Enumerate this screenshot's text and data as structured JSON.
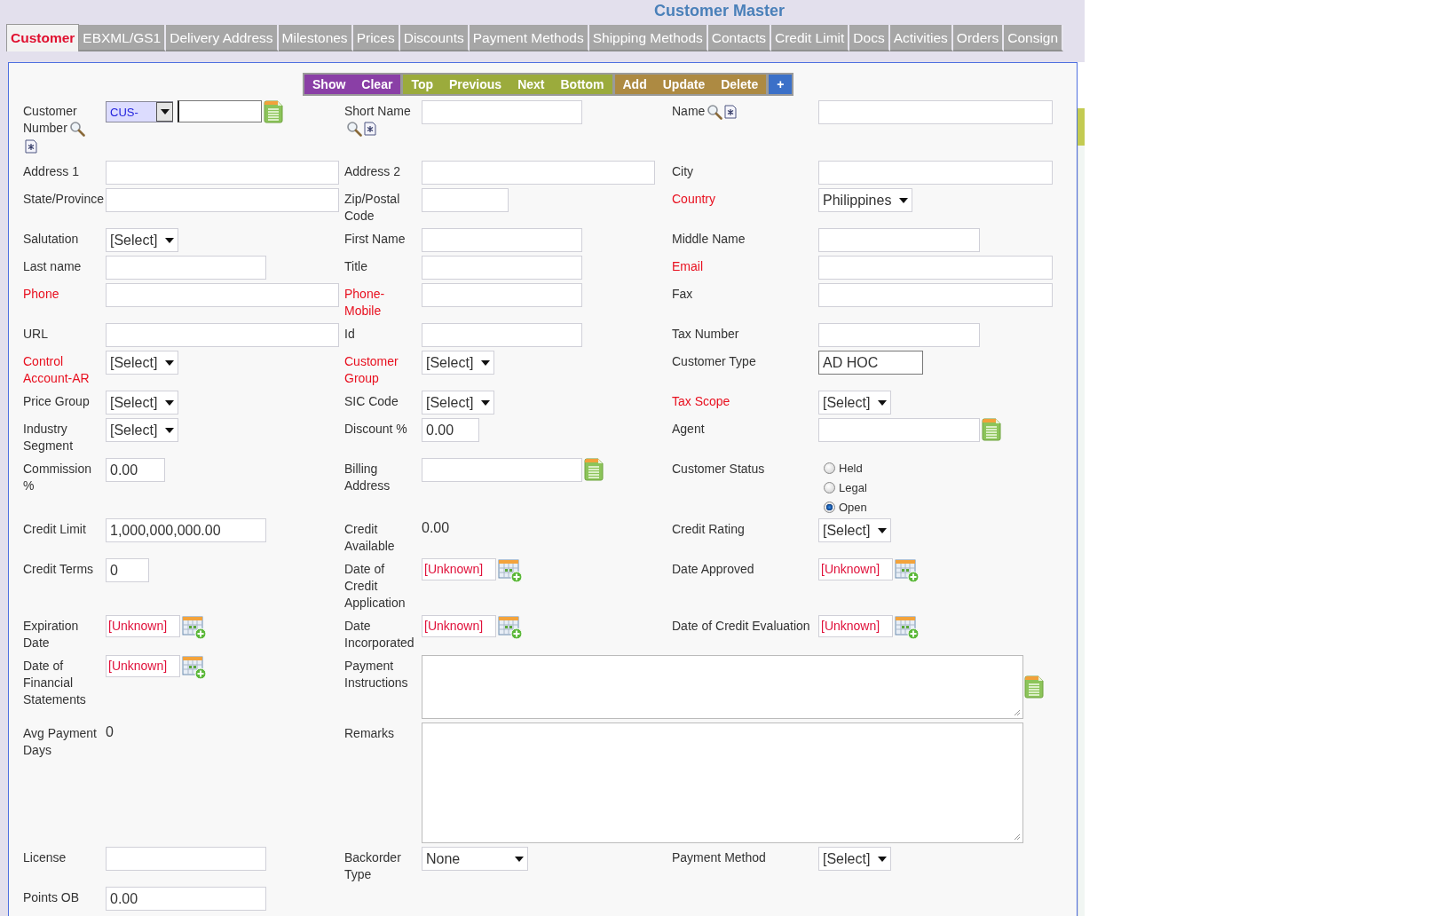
{
  "title": "Customer Master",
  "tabs": [
    {
      "label": "Customer",
      "selected": true
    },
    {
      "label": "EBXML/GS1",
      "selected": false
    },
    {
      "label": "Delivery Address",
      "selected": false
    },
    {
      "label": "Milestones",
      "selected": false
    },
    {
      "label": "Prices",
      "selected": false
    },
    {
      "label": "Discounts",
      "selected": false
    },
    {
      "label": "Payment Methods",
      "selected": false
    },
    {
      "label": "Shipping Methods",
      "selected": false
    },
    {
      "label": "Contacts",
      "selected": false
    },
    {
      "label": "Credit Limit",
      "selected": false
    },
    {
      "label": "Docs",
      "selected": false
    },
    {
      "label": "Activities",
      "selected": false
    },
    {
      "label": "Orders",
      "selected": false
    },
    {
      "label": "Consign",
      "selected": false
    }
  ],
  "toolbar": [
    {
      "label": "Show",
      "color": "#8a3fa6"
    },
    {
      "label": "Clear",
      "color": "#8a3fa6"
    },
    {
      "label": "Top",
      "color": "#9bab3c"
    },
    {
      "label": "Previous",
      "color": "#9bab3c"
    },
    {
      "label": "Next",
      "color": "#9bab3c"
    },
    {
      "label": "Bottom",
      "color": "#9bab3c"
    },
    {
      "label": "Add",
      "color": "#ad8a42"
    },
    {
      "label": "Update",
      "color": "#ad8a42"
    },
    {
      "label": "Delete",
      "color": "#ad8a42"
    },
    {
      "label": "+",
      "color": "#3b70c8"
    }
  ],
  "rows": [
    {
      "cells": [
        {
          "label": "Customer Number",
          "required": false,
          "lookup": true,
          "control": {
            "kind": "customer-number",
            "prefix": "CUS-"
          }
        },
        {
          "label": "Short Name",
          "required": false,
          "lookup": true,
          "control": {
            "kind": "text"
          }
        },
        {
          "label": "Name",
          "required": false,
          "lookup": true,
          "control": {
            "kind": "text"
          }
        }
      ]
    },
    {
      "cells": [
        {
          "label": "Address 1",
          "required": false,
          "control": {
            "kind": "text"
          }
        },
        {
          "label": "Address 2",
          "required": false,
          "control": {
            "kind": "text"
          }
        },
        {
          "label": "City",
          "required": false,
          "control": {
            "kind": "text"
          }
        }
      ]
    },
    {
      "cells": [
        {
          "label": "State/Province",
          "required": false,
          "control": {
            "kind": "text"
          }
        },
        {
          "label": "Zip/Postal Code",
          "required": false,
          "control": {
            "kind": "text"
          }
        },
        {
          "label": "Country",
          "required": true,
          "control": {
            "kind": "select",
            "value": "Philippines"
          }
        }
      ]
    },
    {
      "cells": [
        {
          "label": "Salutation",
          "required": false,
          "control": {
            "kind": "select",
            "value": "[Select]"
          }
        },
        {
          "label": "First Name",
          "required": false,
          "control": {
            "kind": "text"
          }
        },
        {
          "label": "Middle Name",
          "required": false,
          "control": {
            "kind": "text"
          }
        }
      ]
    },
    {
      "cells": [
        {
          "label": "Last name",
          "required": false,
          "control": {
            "kind": "text"
          }
        },
        {
          "label": "Title",
          "required": false,
          "control": {
            "kind": "text"
          }
        },
        {
          "label": "Email",
          "required": true,
          "control": {
            "kind": "text"
          }
        }
      ]
    },
    {
      "cells": [
        {
          "label": "Phone",
          "required": true,
          "control": {
            "kind": "text"
          }
        },
        {
          "label": "Phone-Mobile",
          "required": true,
          "control": {
            "kind": "text"
          }
        },
        {
          "label": "Fax",
          "required": false,
          "control": {
            "kind": "text"
          }
        }
      ]
    },
    {
      "cells": [
        {
          "label": "URL",
          "required": false,
          "control": {
            "kind": "text"
          }
        },
        {
          "label": "Id",
          "required": false,
          "control": {
            "kind": "text"
          }
        },
        {
          "label": "Tax Number",
          "required": false,
          "control": {
            "kind": "text"
          }
        }
      ]
    },
    {
      "cells": [
        {
          "label": "Control Account-AR",
          "required": true,
          "control": {
            "kind": "select",
            "value": "[Select]"
          }
        },
        {
          "label": "Customer Group",
          "required": true,
          "control": {
            "kind": "select",
            "value": "[Select]"
          }
        },
        {
          "label": "Customer Type",
          "required": false,
          "control": {
            "kind": "text",
            "value": "AD HOC"
          }
        }
      ]
    },
    {
      "cells": [
        {
          "label": "Price Group",
          "required": false,
          "control": {
            "kind": "select",
            "value": "[Select]"
          }
        },
        {
          "label": "SIC Code",
          "required": false,
          "control": {
            "kind": "select",
            "value": "[Select]"
          }
        },
        {
          "label": "Tax Scope",
          "required": true,
          "control": {
            "kind": "select",
            "value": "[Select]"
          }
        }
      ]
    },
    {
      "cells": [
        {
          "label": "Industry Segment",
          "required": false,
          "control": {
            "kind": "select",
            "value": "[Select]"
          }
        },
        {
          "label": "Discount %",
          "required": false,
          "control": {
            "kind": "text",
            "value": "0.00"
          }
        },
        {
          "label": "Agent",
          "required": false,
          "control": {
            "kind": "text",
            "picker": true
          }
        }
      ]
    },
    {
      "cells": [
        {
          "label": "Commission %",
          "required": false,
          "control": {
            "kind": "text",
            "value": "0.00"
          }
        },
        {
          "label": "Billing Address",
          "required": false,
          "control": {
            "kind": "text",
            "picker": true
          }
        },
        {
          "label": "Customer Status",
          "required": false,
          "control": {
            "kind": "radio",
            "options": [
              {
                "label": "Held",
                "selected": false
              },
              {
                "label": "Legal",
                "selected": false
              },
              {
                "label": "Open",
                "selected": true
              }
            ]
          }
        }
      ]
    },
    {
      "cells": [
        {
          "label": "Credit Limit",
          "required": false,
          "control": {
            "kind": "text",
            "value": "1,000,000,000.00"
          }
        },
        {
          "label": "Credit Available",
          "required": false,
          "control": {
            "kind": "static",
            "value": "0.00"
          }
        },
        {
          "label": "Credit Rating",
          "required": false,
          "control": {
            "kind": "select",
            "value": "[Select]"
          }
        }
      ]
    },
    {
      "cells": [
        {
          "label": "Credit Terms",
          "required": false,
          "control": {
            "kind": "text",
            "value": "0"
          }
        },
        {
          "label": "Date of Credit Application",
          "required": false,
          "control": {
            "kind": "date",
            "value": "[Unknown]"
          }
        },
        {
          "label": "Date Approved",
          "required": false,
          "control": {
            "kind": "date",
            "value": "[Unknown]"
          }
        }
      ]
    },
    {
      "cells": [
        {
          "label": "Expiration Date",
          "required": false,
          "control": {
            "kind": "date",
            "value": "[Unknown]"
          }
        },
        {
          "label": "Date Incorporated",
          "required": false,
          "control": {
            "kind": "date",
            "value": "[Unknown]"
          }
        },
        {
          "label": "Date of Credit Evaluation",
          "required": false,
          "control": {
            "kind": "date",
            "value": "[Unknown]"
          }
        }
      ]
    },
    {
      "cells": [
        {
          "label": "Date of Financial Statements",
          "required": false,
          "control": {
            "kind": "date",
            "value": "[Unknown]"
          }
        },
        {
          "label": "Payment Instructions",
          "required": false,
          "control": {
            "kind": "textarea",
            "picker": true
          }
        }
      ]
    },
    {
      "cells": [
        {
          "label": "Avg Payment Days",
          "required": false,
          "control": {
            "kind": "static",
            "value": "0"
          }
        },
        {
          "label": "Remarks",
          "required": false,
          "control": {
            "kind": "textarea"
          }
        }
      ]
    },
    {
      "cells": [
        {
          "label": "License",
          "required": false,
          "control": {
            "kind": "text"
          }
        },
        {
          "label": "Backorder Type",
          "required": false,
          "control": {
            "kind": "select",
            "value": "None"
          }
        },
        {
          "label": "Payment Method",
          "required": false,
          "control": {
            "kind": "select",
            "value": "[Select]"
          }
        }
      ]
    },
    {
      "cells": [
        {
          "label": "Points OB",
          "required": false,
          "control": {
            "kind": "text",
            "value": "0.00"
          }
        }
      ]
    }
  ]
}
